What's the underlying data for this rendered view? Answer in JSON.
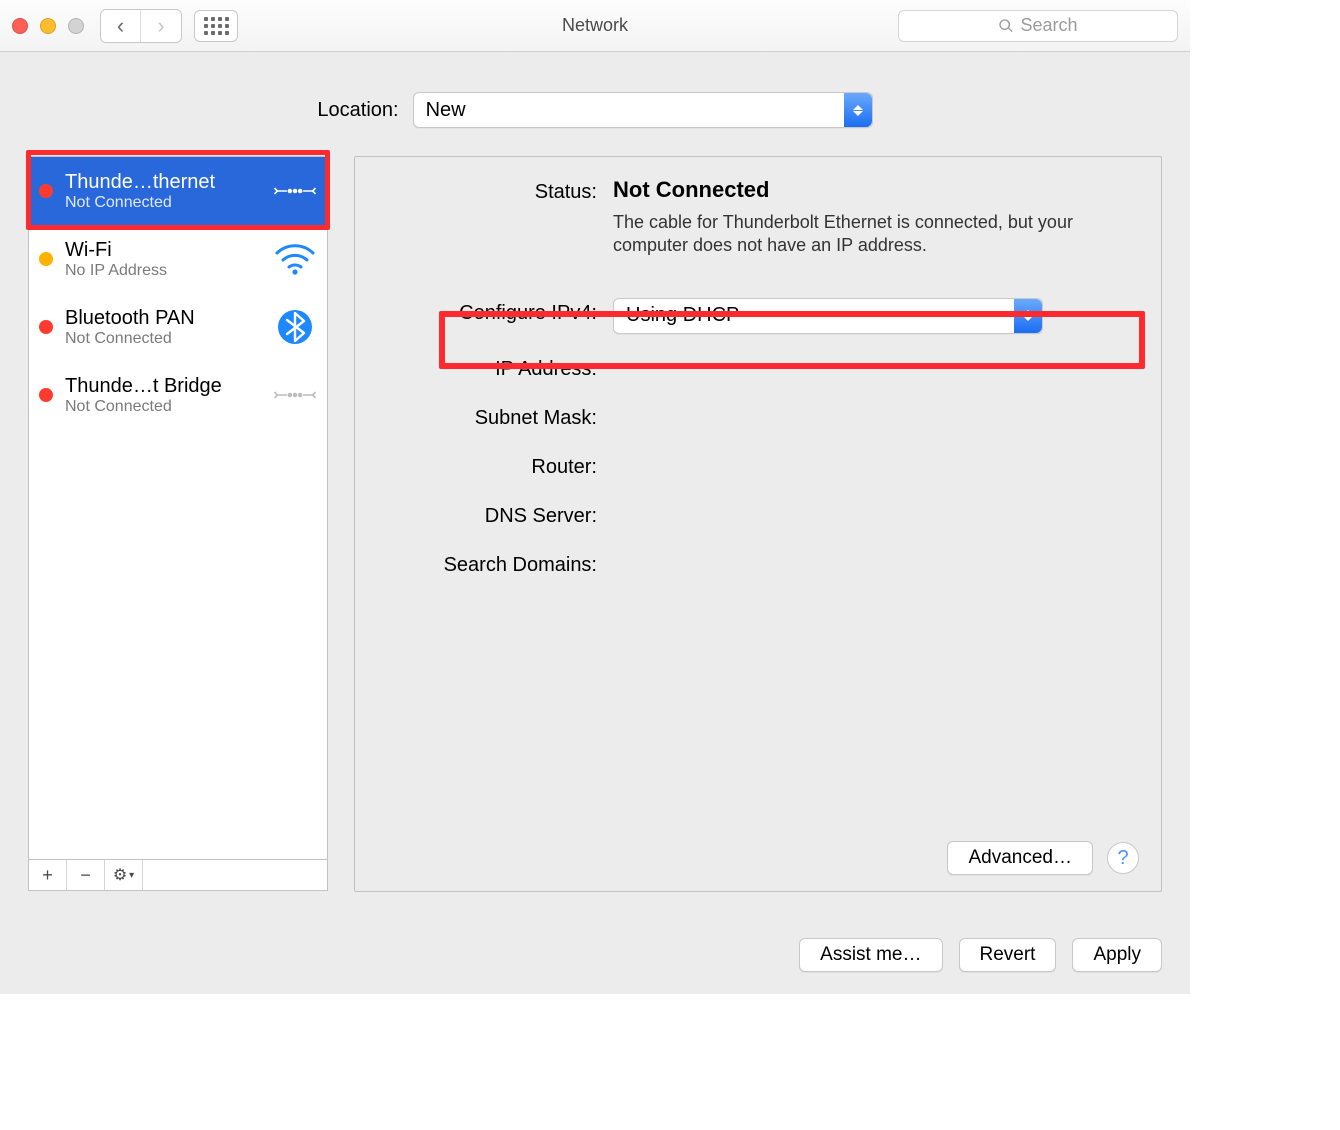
{
  "window": {
    "title": "Network",
    "search_placeholder": "Search"
  },
  "location": {
    "label": "Location:",
    "value": "New"
  },
  "sidebar": {
    "services": [
      {
        "name": "Thunde…thernet",
        "status": "Not Connected",
        "dot": "red",
        "icon": "ethernet",
        "selected": true
      },
      {
        "name": "Wi-Fi",
        "status": "No IP Address",
        "dot": "orange",
        "icon": "wifi",
        "selected": false
      },
      {
        "name": "Bluetooth PAN",
        "status": "Not Connected",
        "dot": "red",
        "icon": "bluetooth",
        "selected": false
      },
      {
        "name": "Thunde…t Bridge",
        "status": "Not Connected",
        "dot": "red",
        "icon": "ethernet-gray",
        "selected": false
      }
    ],
    "footer": {
      "add": "+",
      "remove": "−",
      "gear": "✻"
    }
  },
  "detail": {
    "status_label": "Status:",
    "status_value": "Not Connected",
    "status_desc": "The cable for Thunderbolt Ethernet is connected, but your computer does not have an IP address.",
    "configure_ipv4_label": "Configure IPv4:",
    "configure_ipv4_value": "Using DHCP",
    "ip_address_label": "IP Address:",
    "subnet_label": "Subnet Mask:",
    "router_label": "Router:",
    "dns_label": "DNS Server:",
    "search_domains_label": "Search Domains:",
    "advanced_label": "Advanced…"
  },
  "actions": {
    "assist": "Assist me…",
    "revert": "Revert",
    "apply": "Apply"
  }
}
